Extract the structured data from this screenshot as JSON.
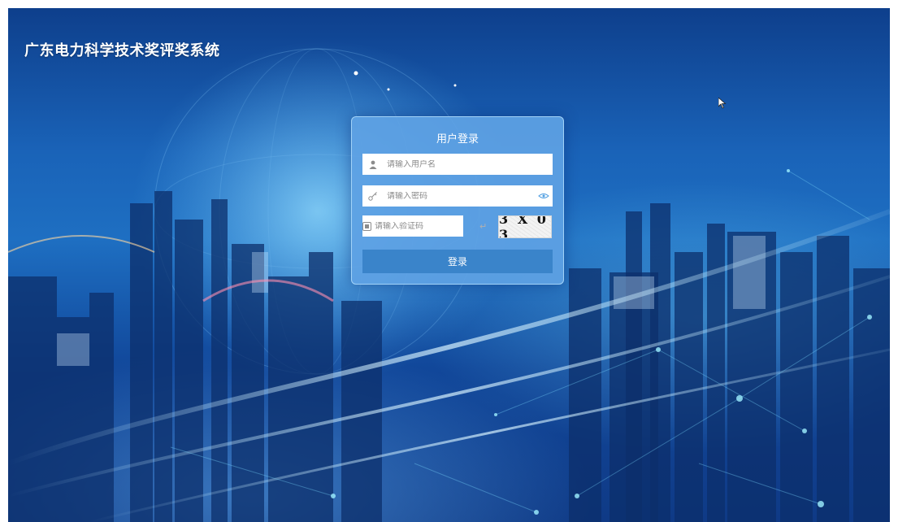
{
  "header": {
    "system_title": "广东电力科学技术奖评奖系统"
  },
  "login": {
    "title": "用户登录",
    "username_placeholder": "请输入用户名",
    "password_placeholder": "请输入密码",
    "captcha_placeholder": "请输入验证码",
    "captcha_text": "3 X 0 3",
    "submit_label": "登录"
  },
  "icons": {
    "username": "user-icon",
    "password": "key-icon",
    "captcha": "captcha-icon",
    "show_password": "eye-icon",
    "enter": "enter-icon",
    "cursor": "mouse-cursor-icon"
  },
  "colors": {
    "panel": "#5ea2e4",
    "button": "#3a84ca",
    "background": "#1a63b8"
  }
}
